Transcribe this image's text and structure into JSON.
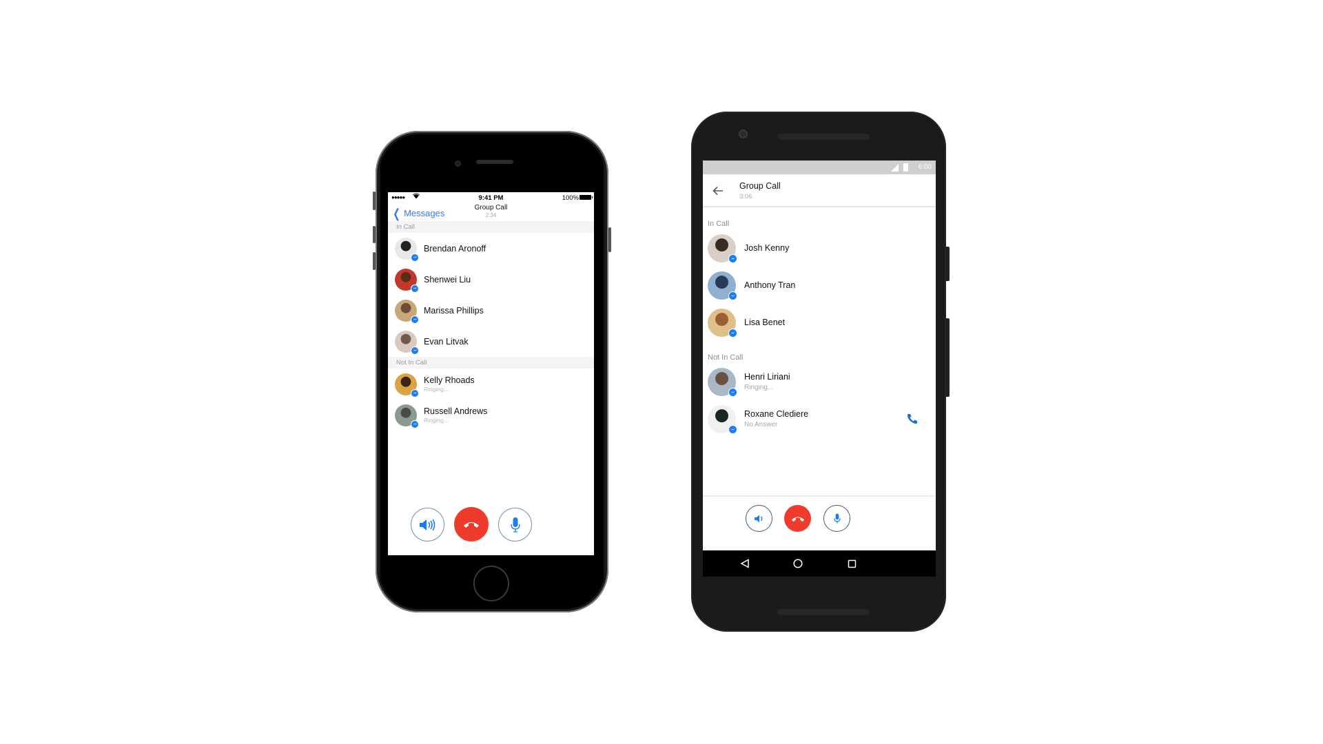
{
  "iphone": {
    "status_bar": {
      "signal": "●●●●●",
      "wifi": "wifi-icon",
      "time": "9:41 PM",
      "battery": "100%"
    },
    "nav": {
      "back_label": "Messages",
      "title": "Group Call",
      "duration": "2:34"
    },
    "sections": [
      {
        "label": "In Call",
        "contacts": [
          {
            "name": "Brendan Aronoff",
            "status": "",
            "avatar_colors": [
              "#e8e8e8",
              "#222222"
            ]
          },
          {
            "name": "Shenwei Liu",
            "status": "",
            "avatar_colors": [
              "#c0392b",
              "#5a2a1a"
            ]
          },
          {
            "name": "Marissa Phillips",
            "status": "",
            "avatar_colors": [
              "#c9a877",
              "#6b4d3a"
            ]
          },
          {
            "name": "Evan Litvak",
            "status": "",
            "avatar_colors": [
              "#d9c9c0",
              "#6e5a4e"
            ]
          }
        ]
      },
      {
        "label": "Not In Call",
        "contacts": [
          {
            "name": "Kelly Rhoads",
            "status": "Ringing...",
            "avatar_colors": [
              "#d9a441",
              "#3b2418"
            ]
          },
          {
            "name": "Russell Andrews",
            "status": "Ringing...",
            "avatar_colors": [
              "#8a9a8e",
              "#4a4a4a"
            ]
          }
        ]
      }
    ],
    "controls": {
      "speaker": "speaker-icon",
      "end_call": "end-call-icon",
      "mute": "microphone-icon"
    }
  },
  "android": {
    "status_bar": {
      "time": "6:00"
    },
    "appbar": {
      "title": "Group Call",
      "duration": "3:06"
    },
    "sections": [
      {
        "label": "In Call",
        "contacts": [
          {
            "name": "Josh Kenny",
            "status": "",
            "avatar_colors": [
              "#d8d0c8",
              "#3a2a22"
            ],
            "call_button": false
          },
          {
            "name": "Anthony Tran",
            "status": "",
            "avatar_colors": [
              "#8fb0d0",
              "#2a3a55"
            ],
            "call_button": false
          },
          {
            "name": "Lisa Benet",
            "status": "",
            "avatar_colors": [
              "#e0c08a",
              "#9a6030"
            ],
            "call_button": false
          }
        ]
      },
      {
        "label": "Not In Call",
        "contacts": [
          {
            "name": "Henri Liriani",
            "status": "Ringing...",
            "avatar_colors": [
              "#a9b8c4",
              "#6a5040"
            ],
            "call_button": false
          },
          {
            "name": "Roxane Clediere",
            "status": "No Answer",
            "avatar_colors": [
              "#f0f0f0",
              "#1a2422"
            ],
            "call_button": true
          }
        ]
      }
    ],
    "controls": {
      "speaker": "speaker-icon",
      "end_call": "end-call-icon",
      "mute": "microphone-icon"
    },
    "navbar": [
      "back-icon",
      "home-icon",
      "recents-icon"
    ]
  },
  "colors": {
    "accent_blue": "#1d7cf2",
    "end_call_red": "#ee3b2b",
    "ios_link": "#3478f6",
    "section_gray": "#f4f4f6"
  }
}
